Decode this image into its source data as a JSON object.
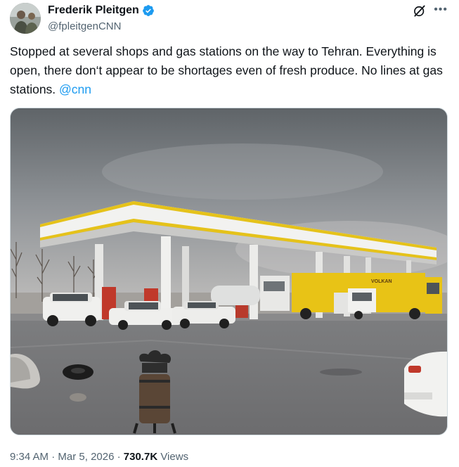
{
  "author": {
    "display_name": "Frederik Pleitgen",
    "handle": "@fpleitgenCNN"
  },
  "tweet": {
    "text": "Stopped at several shops and gas stations on the way to Tehran. Everything is open, there don‘t appear to be shortages even of fresh produce. No lines at gas stations. ",
    "mention": "@cnn"
  },
  "media": {
    "truck_lettering": "VOLKAN"
  },
  "meta": {
    "time": "9:34 AM",
    "separator": " · ",
    "date": "Mar 5, 2026",
    "separator2": " · ",
    "views_count": "730.7K",
    "views_label": " Views"
  },
  "icons": {
    "verified": "verified-badge-icon",
    "grok": "grok-icon",
    "more": "more-icon"
  },
  "colors": {
    "accent": "#1d9bf0",
    "text": "#0f1419",
    "secondary": "#536471"
  }
}
